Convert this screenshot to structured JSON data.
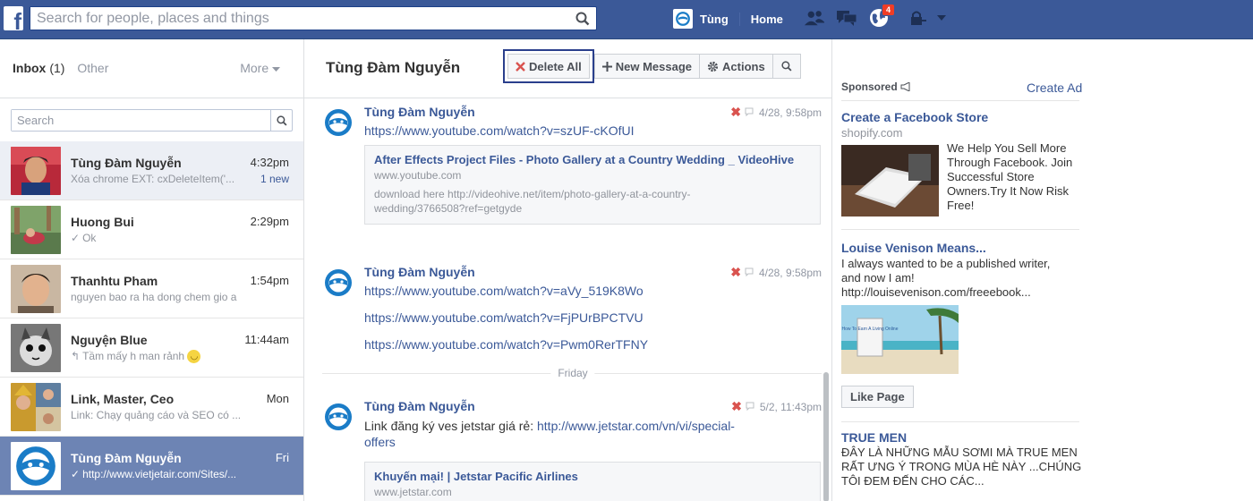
{
  "topbar": {
    "logo_letter": "f",
    "search_placeholder": "Search for people, places and things",
    "user_name": "Tùng",
    "home_label": "Home",
    "notification_count": "4"
  },
  "inbox": {
    "label": "Inbox",
    "count": "(1)",
    "other_label": "Other",
    "more_label": "More",
    "search_placeholder": "Search",
    "threads": [
      {
        "name": "Tùng Đàm Nguyễn",
        "time": "4:32pm",
        "snippet": "Xóa chrome EXT: cxDeleteItem('...",
        "new_label": "1 new"
      },
      {
        "name": "Huong Bui",
        "time": "2:29pm",
        "snippet": "Ok"
      },
      {
        "name": "Thanhtu Pham",
        "time": "1:54pm",
        "snippet": "nguyen bao ra ha dong chem gio a"
      },
      {
        "name": "Nguyện Blue",
        "time": "11:44am",
        "snippet": "Tầm mấy h man rảnh"
      },
      {
        "name": "Link, Master, Ceo",
        "time": "Mon",
        "snippet": "Link: Chạy quảng cáo và SEO có ..."
      },
      {
        "name": "Tùng Đàm Nguyễn",
        "time": "Fri",
        "snippet": "http://www.vietjetair.com/Sites/..."
      }
    ]
  },
  "conversation": {
    "title": "Tùng Đàm Nguyễn",
    "toolbar": {
      "delete_all": "Delete All",
      "new_message": "New Message",
      "actions": "Actions"
    },
    "messages": [
      {
        "sender": "Tùng Đàm Nguyễn",
        "time": "4/28, 9:58pm",
        "link": "https://www.youtube.com/watch?v=szUF-cKOfUI",
        "preview": {
          "title": "After Effects Project Files - Photo Gallery at a Country Wedding _ VideoHive",
          "domain": "www.youtube.com",
          "desc": "download here http://videohive.net/item/photo-gallery-at-a-country-wedding/3766508?ref=getgyde"
        }
      },
      {
        "sender": "Tùng Đàm Nguyễn",
        "time": "4/28, 9:58pm",
        "links": [
          "https://www.youtube.com/watch?v=aVy_519K8Wo",
          "https://www.youtube.com/watch?v=FjPUrBPCTVU",
          "https://www.youtube.com/watch?v=Pwm0RerTFNY"
        ]
      },
      {
        "sender": "Tùng Đàm Nguyễn",
        "time": "5/2, 11:43pm",
        "text": "Link đăng ký ves jetstar giá rẻ: ",
        "text_link": "http://www.jetstar.com/vn/vi/special-offers",
        "preview": {
          "title": "Khuyến mại! | Jetstar Pacific Airlines",
          "domain": "www.jetstar.com"
        }
      }
    ],
    "day_separator": "Friday"
  },
  "ads": {
    "sponsored_label": "Sponsored",
    "create_ad": "Create Ad",
    "items": [
      {
        "title": "Create a Facebook Store",
        "domain": "shopify.com",
        "text": "We Help You Sell More Through Facebook. Join Successful Store Owners.Try It Now Risk Free!"
      },
      {
        "title": "Louise Venison Means...",
        "text": "I always wanted to be a published writer, and now I am! http://louisevenison.com/freeebook...",
        "book_text": "How To Earn A Living Online",
        "like_label": "Like Page"
      },
      {
        "title": "TRUE MEN",
        "text": "ĐÂY LÀ NHỮNG MẪU SƠMI MÀ TRUE MEN RẤT ƯNG Ý TRONG MÙA HÈ NÀY ...CHÚNG TÔI ĐEM ĐẾN CHO CÁC..."
      }
    ]
  },
  "colors": {
    "brand": "#3b5998",
    "selected_thread": "#6d84b4",
    "delete_x": "#d9534f"
  }
}
